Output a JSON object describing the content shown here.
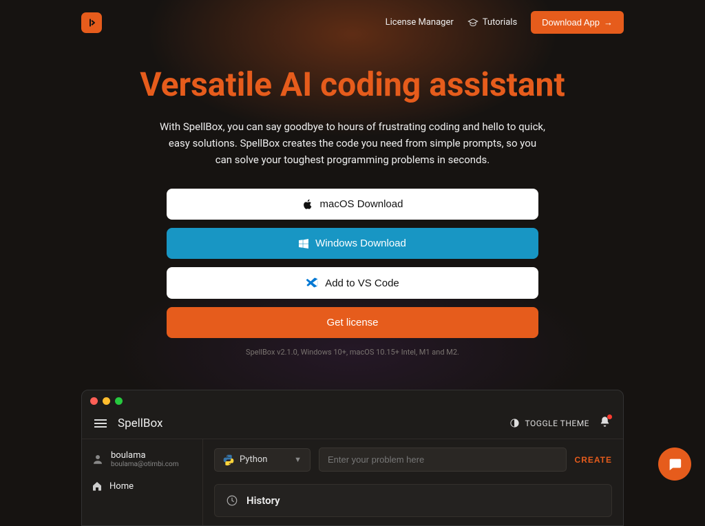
{
  "nav": {
    "license_manager": "License Manager",
    "tutorials": "Tutorials",
    "download_app": "Download App"
  },
  "hero": {
    "title": "Versatile AI coding assistant",
    "subtitle": "With SpellBox, you can say goodbye to hours of frustrating coding and hello to quick, easy solutions. SpellBox creates the code you need from simple prompts, so you can solve your toughest programming problems in seconds."
  },
  "downloads": {
    "macos": "macOS Download",
    "windows": "Windows Download",
    "vscode": "Add to VS Code",
    "license": "Get license"
  },
  "version": "SpellBox v2.1.0, Windows 10+, macOS 10.15+ Intel, M1 and M2.",
  "app": {
    "title": "SpellBox",
    "toggle_theme": "TOGGLE THEME",
    "user": {
      "name": "boulama",
      "email": "boulama@otimbi.com"
    },
    "sidebar": {
      "home": "Home"
    },
    "lang_selected": "Python",
    "input_placeholder": "Enter your problem here",
    "create": "CREATE",
    "history": "History"
  },
  "colors": {
    "accent": "#e65c1c",
    "blue": "#1896c4"
  }
}
